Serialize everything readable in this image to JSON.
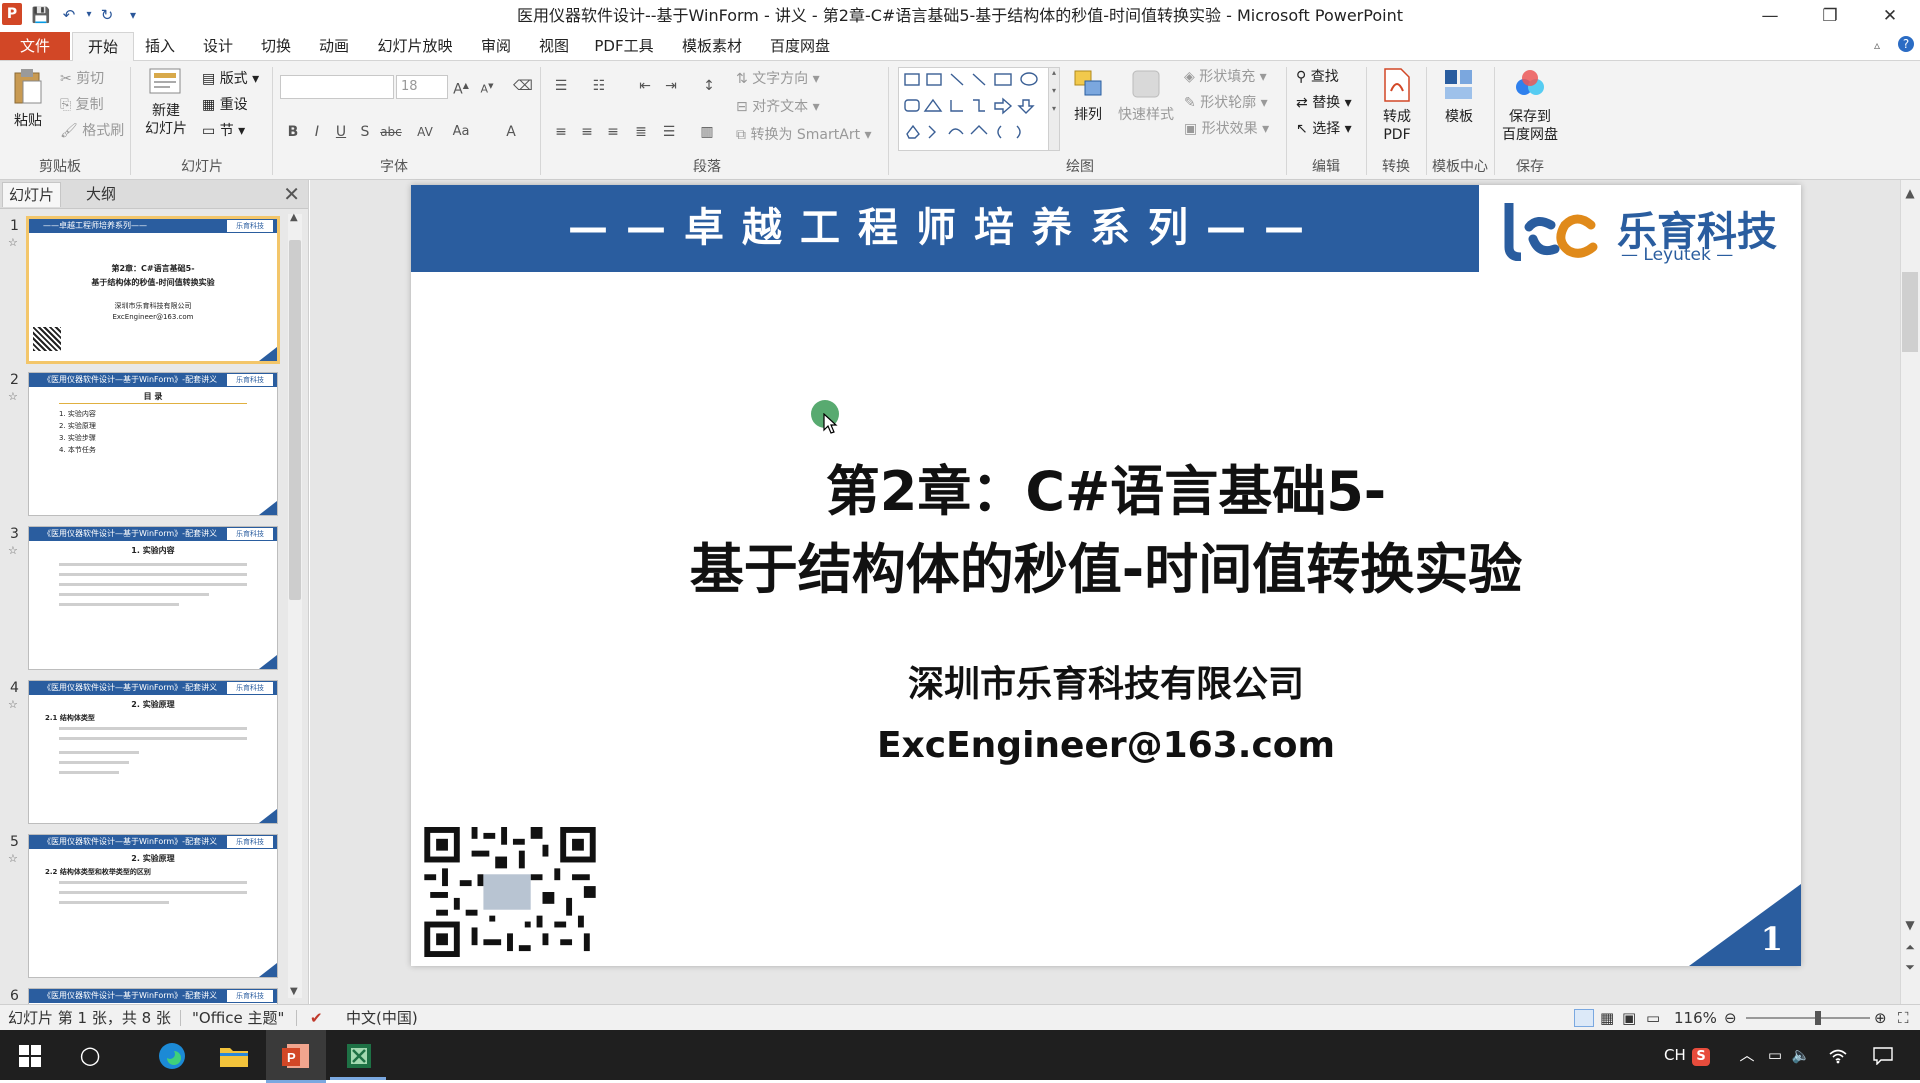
{
  "titlebar": {
    "app_icon": "P",
    "title": "医用仪器软件设计--基于WinForm - 讲义 - 第2章-C#语言基础5-基于结构体的秒值-时间值转换实验 - Microsoft PowerPoint",
    "minimize": "—",
    "restore": "❐",
    "close": "✕"
  },
  "tabs": [
    "文件",
    "开始",
    "插入",
    "设计",
    "切换",
    "动画",
    "幻灯片放映",
    "审阅",
    "视图",
    "PDF工具",
    "模板素材",
    "百度网盘"
  ],
  "ribbon": {
    "clipboard": {
      "paste": "粘贴",
      "cut": "剪切",
      "copy": "复制",
      "format_painter": "格式刷",
      "label": "剪贴板"
    },
    "slides": {
      "new_slide_l1": "新建",
      "new_slide_l2": "幻灯片",
      "layout": "版式",
      "reset": "重设",
      "section": "节",
      "label": "幻灯片"
    },
    "font": {
      "font_size": "18",
      "label": "字体"
    },
    "paragraph": {
      "text_direction": "文字方向",
      "align_text": "对齐文本",
      "smartart": "转换为 SmartArt",
      "label": "段落"
    },
    "drawing": {
      "arrange": "排列",
      "quick_styles": "快速样式",
      "shape_fill": "形状填充",
      "shape_outline": "形状轮廓",
      "shape_effects": "形状效果",
      "label": "绘图"
    },
    "editing": {
      "find": "查找",
      "replace": "替换",
      "select": "选择",
      "label": "编辑"
    },
    "convert": {
      "to_pdf_l1": "转成",
      "to_pdf_l2": "PDF",
      "label": "转换"
    },
    "template": {
      "template": "模板",
      "label": "模板中心"
    },
    "save": {
      "save_l1": "保存到",
      "save_l2": "百度网盘",
      "label": "保存"
    }
  },
  "left_pane": {
    "tab_slides": "幻灯片",
    "tab_outline": "大纲",
    "close": "✕",
    "thumbs": [
      {
        "num": "1",
        "head": "——卓越工程师培养系列——",
        "sub1": "第2章：C#语言基础5-",
        "sub2": "基于结构体的秒值-时间值转换实验",
        "sub3": "深圳市乐育科技有限公司",
        "sub4": "ExcEngineer@163.com"
      },
      {
        "num": "2",
        "head": "《医用仪器软件设计—基于WinForm》-配套讲义",
        "sub1": "目  录",
        "items": [
          "1. 实验内容",
          "2. 实验原理",
          "3. 实验步骤",
          "4. 本节任务"
        ]
      },
      {
        "num": "3",
        "head": "《医用仪器软件设计—基于WinForm》-配套讲义",
        "sub1": "1. 实验内容"
      },
      {
        "num": "4",
        "head": "《医用仪器软件设计—基于WinForm》-配套讲义",
        "sub1": "2. 实验原理",
        "sub2": "2.1 结构体类型"
      },
      {
        "num": "5",
        "head": "《医用仪器软件设计—基于WinForm》-配套讲义",
        "sub1": "2. 实验原理",
        "sub2": "2.2 结构体类型和枚举类型的区别"
      },
      {
        "num": "6",
        "head": "《医用仪器软件设计—基于WinForm》-配套讲义"
      }
    ],
    "thumb_logo": "乐育科技"
  },
  "slide": {
    "banner": "——卓越工程师培养系列——",
    "logo_cn": "乐育科技",
    "logo_en": "— Leyutek —",
    "title_line1": "第2章：C#语言基础5-",
    "title_line2": "基于结构体的秒值-时间值转换实验",
    "company": "深圳市乐育科技有限公司",
    "email": "ExcEngineer@163.com",
    "page_number": "1"
  },
  "statusbar": {
    "slide_info": "幻灯片 第 1 张，共 8 张",
    "theme": "\"Office 主题\"",
    "language": "中文(中国)",
    "zoom": "116%",
    "zoom_level": 0.58
  },
  "taskbar": {
    "ime": "CH",
    "ime_s": "S"
  },
  "colors": {
    "accent": "#2a5d9f",
    "file_tab": "#d24726",
    "selected_thumb": "#f3c66a"
  }
}
